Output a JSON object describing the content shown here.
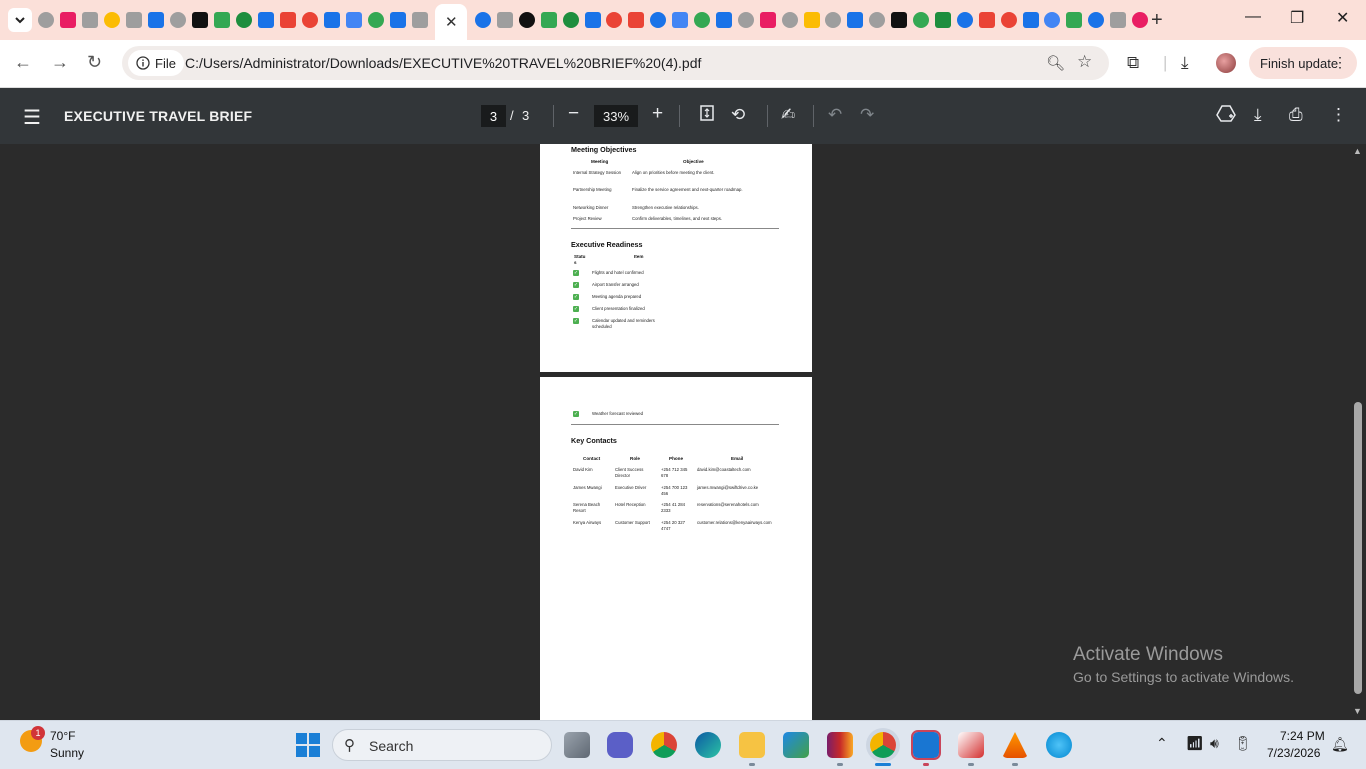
{
  "browser": {
    "new_tab": "+",
    "active_tab_close": "✕",
    "window": {
      "minimize": "—",
      "restore": "❐",
      "close": "✕"
    }
  },
  "toolbar": {
    "chip_label": "File",
    "url": "C:/Users/Administrator/Downloads/EXECUTIVE%20TRAVEL%20BRIEF%20(4).pdf",
    "finish_update": "Finish update"
  },
  "pdf": {
    "title": "EXECUTIVE TRAVEL BRIEF",
    "current_page": "3",
    "page_sep": "/",
    "total_pages": "3",
    "zoom": "33%",
    "zoom_out": "−",
    "zoom_in": "+"
  },
  "doc": {
    "meeting_objectives": {
      "title": "Meeting Objectives",
      "headers": [
        "Meeting",
        "Objective"
      ],
      "rows": [
        [
          "Internal Strategy Session",
          "Align on priorities before meeting the client."
        ],
        [
          "Partnership Meeting",
          "Finalize the service agreement and next-quarter roadmap."
        ],
        [
          "Networking Dinner",
          "Strengthen executive relationships."
        ],
        [
          "Project Review",
          "Confirm deliverables, timelines, and next steps."
        ]
      ]
    },
    "executive_readiness": {
      "title": "Executive Readiness",
      "headers": [
        "Status",
        "Item"
      ],
      "items": [
        "Flights and hotel confirmed",
        "Airport transfer arranged",
        "Meeting agenda prepared",
        "Client presentation finalized",
        "Calendar updated and reminders scheduled",
        "Weather forecast reviewed"
      ]
    },
    "key_contacts": {
      "title": "Key Contacts",
      "headers": [
        "Contact",
        "Role",
        "Phone",
        "Email"
      ],
      "rows": [
        [
          "David Kim",
          "Client Success Director",
          "+254 712 345 678",
          "david.kim@coastaltech.com"
        ],
        [
          "James Mwangi",
          "Executive Driver",
          "+254 700 123 456",
          "james.mwangi@swiftdrive.co.ke"
        ],
        [
          "Serena Beach Resort",
          "Hotel Reception",
          "+254 41 284 2333",
          "reservations@serenahotels.com"
        ],
        [
          "Kenya Airways",
          "Customer Support",
          "+254 20 327 4747",
          "customer.relations@kenyaairways.com"
        ]
      ]
    }
  },
  "watermark": {
    "line1": "Activate Windows",
    "line2": "Go to Settings to activate Windows."
  },
  "taskbar": {
    "weather_badge": "1",
    "temperature": "70°F",
    "condition": "Sunny",
    "search_label": "Search",
    "time": "7:24 PM",
    "date": "7/23/2026"
  },
  "colors": {
    "tabstrip": "#fbe0d9",
    "pdf_toolbar": "#323639",
    "viewer_bg": "#2b2b2b",
    "taskbar": "#dfe6ef",
    "checkbox_green": "#4caf50"
  }
}
